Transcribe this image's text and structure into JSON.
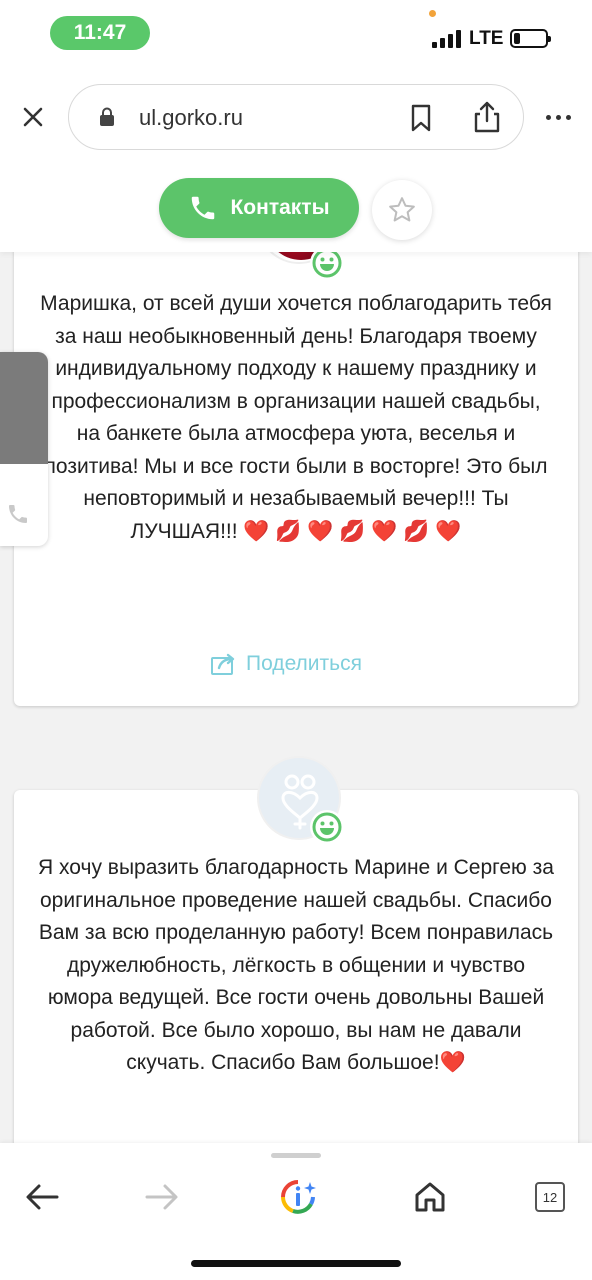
{
  "status_bar": {
    "time": "11:47",
    "network": "LTE",
    "signal_bars": 4,
    "battery_level": 0.15,
    "time_pill_color": "#5ac86a"
  },
  "browser": {
    "url": "ul.gorko.ru",
    "icons": {
      "close": "close-icon",
      "lock": "lock-icon",
      "bookmark": "bookmark-icon",
      "share": "share-icon",
      "more": "more-icon"
    }
  },
  "page": {
    "contacts_label": "Контакты",
    "accent_color": "#5cc46a",
    "share_color": "#7fcfdc",
    "reviews": [
      {
        "text": "Маришка, от всей души хочется поблагодарить тебя за наш необыкновенный день! Благодаря твоему индивидуальному подходу к нашему празднику и профессионализм в организации нашей свадьбы, на банкете была атмосфера уюта, веселья и позитива! Мы и все гости были в восторге! Это был неповторимый и незабываемый вечер!!! Ты ЛУЧШАЯ!!! ",
        "emoji_line": "❤️ 💋 ❤️ 💋 ❤️ 💋 ❤️",
        "share_label": "Поделиться",
        "rating_icon": "smiley-icon"
      },
      {
        "text": "Я хочу выразить благодарность Марине и Сергею за оригинальное проведение нашей свадьбы. Спасибо Вам за всю проделанную работу! Всем понравилась дружелюбность, лёгкость в общении и чувство юмора ведущей. Все гости очень довольны Вашей работой. Все было хорошо, вы нам не давали скучать. Спасибо Вам большое!",
        "emoji_line": "❤️",
        "rating_icon": "smiley-icon"
      }
    ]
  },
  "toolbar": {
    "tab_count": "12",
    "icons": [
      "back-arrow-icon",
      "forward-arrow-icon",
      "google-lens-icon",
      "home-icon",
      "tabs-icon"
    ]
  }
}
